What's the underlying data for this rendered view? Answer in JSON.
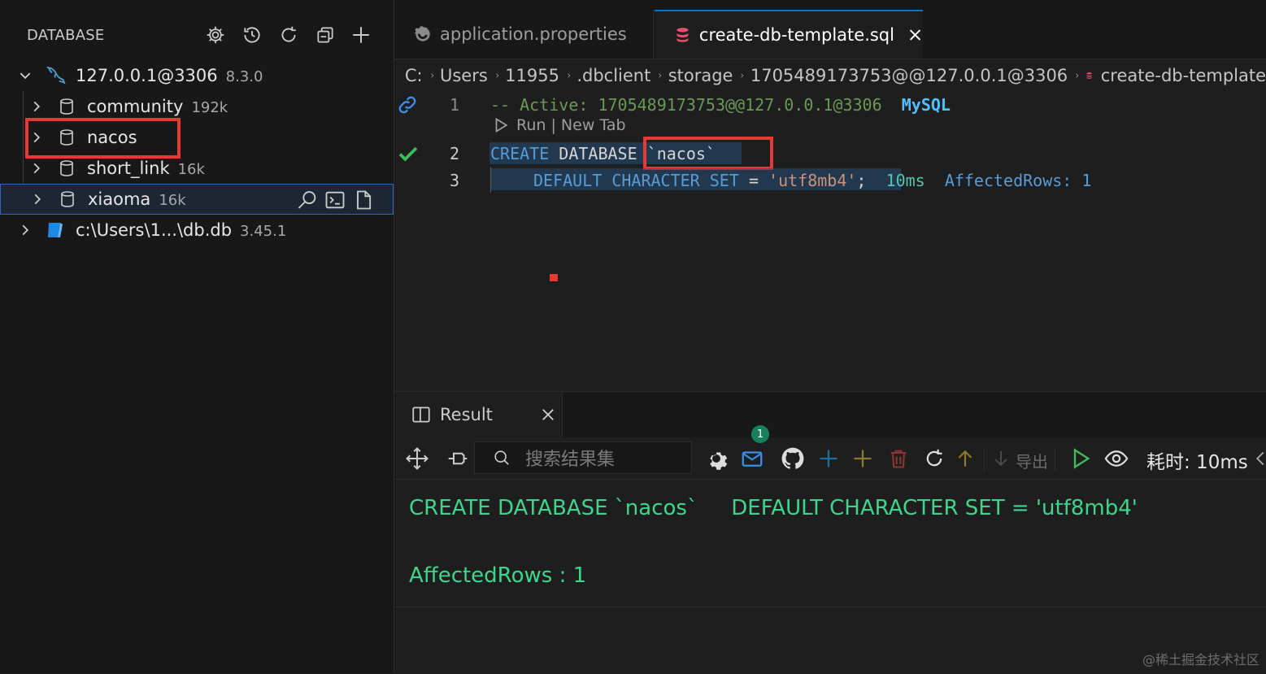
{
  "sidebar": {
    "title": "DATABASE",
    "connection": {
      "label": "127.0.0.1@3306",
      "version": "8.3.0"
    },
    "databases": [
      {
        "label": "community",
        "size": "192k"
      },
      {
        "label": "nacos",
        "size": ""
      },
      {
        "label": "short_link",
        "size": "16k"
      },
      {
        "label": "xiaoma",
        "size": "16k"
      }
    ],
    "sqlite": {
      "label": "c:\\Users\\1...\\db.db",
      "version": "3.45.1"
    }
  },
  "tabs": [
    {
      "label": "application.properties"
    },
    {
      "label": "create-db-template.sql"
    }
  ],
  "breadcrumb": [
    "C:",
    "Users",
    "11955",
    ".dbclient",
    "storage",
    "1705489173753@@127.0.0.1@3306",
    "create-db-template"
  ],
  "editor": {
    "line1": {
      "num": "1",
      "comment": "-- Active: 1705489173753@@127.0.0.1@3306",
      "db": "MySQL"
    },
    "codelens": "Run | New Tab",
    "line2": {
      "num": "2",
      "kw1": "CREATE",
      "kw2": "DATABAS",
      "caret": "E",
      "name": "`nacos`"
    },
    "line3": {
      "num": "3",
      "kw1": "DEFAULT",
      "kw2": "CHARACTER",
      "kw3": "SET",
      "eq": "=",
      "value": "'utf8mb4'",
      "semi": ";",
      "time": "10ms",
      "rows": "AffectedRows: 1"
    }
  },
  "result": {
    "tab_label": "Result",
    "search_placeholder": "搜索结果集",
    "mail_badge": "1",
    "export_label": "导出",
    "elapsed": "耗时: 10ms",
    "sql_text": "CREATE DATABASE `nacos`     DEFAULT CHARACTER SET = 'utf8mb4'",
    "affected": "AffectedRows : 1"
  },
  "watermark": "@稀土掘金技术社区",
  "colors": {
    "accent": "#0078d4",
    "highlight": "#e53935",
    "success": "#3dd68c",
    "sql_file": "#f14c6b"
  }
}
